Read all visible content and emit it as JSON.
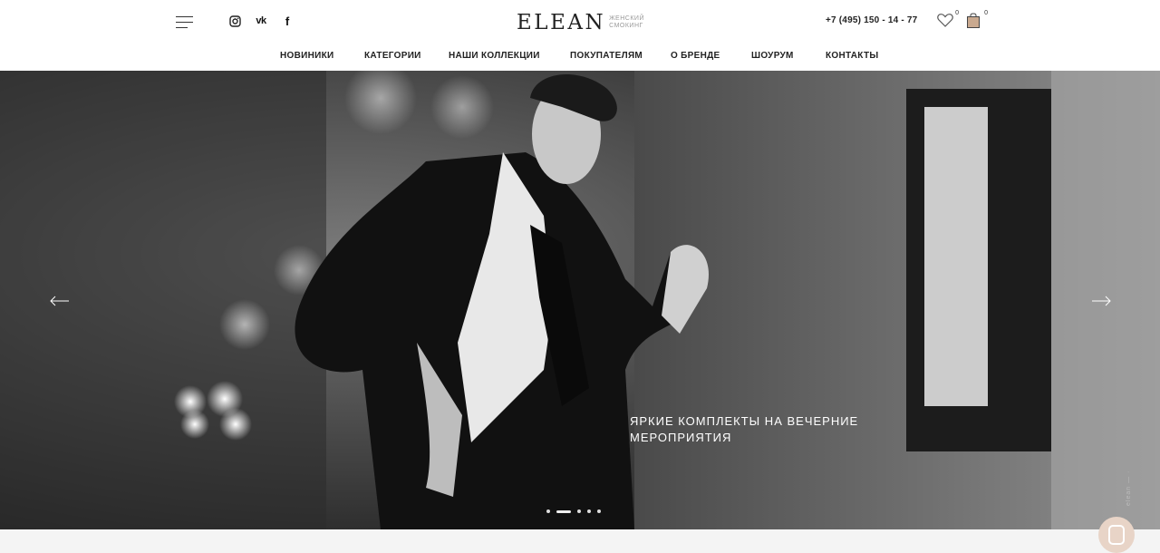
{
  "header": {
    "logo_word": "ELEAN",
    "logo_sub_1": "женский",
    "logo_sub_2": "смокинг",
    "phone": "+7 (495) 150 - 14 - 77",
    "favorites_count": "0",
    "cart_count": "0",
    "socials": [
      "instagram-icon",
      "vk-icon",
      "facebook-icon"
    ],
    "vk_label": "vk",
    "fb_label": "f"
  },
  "nav": {
    "items": [
      {
        "label": "НОВИНИКИ"
      },
      {
        "label": "КАТЕГОРИИ"
      },
      {
        "label": "НАШИ КОЛЛЕКЦИИ"
      },
      {
        "label": "ПОКУПАТЕЛЯМ"
      },
      {
        "label": "О БРЕНДЕ"
      },
      {
        "label": "ШОУРУМ"
      },
      {
        "label": "КОНТАКТЫ"
      }
    ]
  },
  "hero": {
    "caption": "ЯРКИЕ КОМПЛЕКТЫ НА ВЕЧЕРНИЕ МЕРОПРИЯТИЯ",
    "slides_total": 5,
    "active_slide": 2,
    "vertical_label": "elean — ·"
  },
  "colors": {
    "chat_button": "#e8d4c7",
    "strip": "#f4f4f4"
  }
}
